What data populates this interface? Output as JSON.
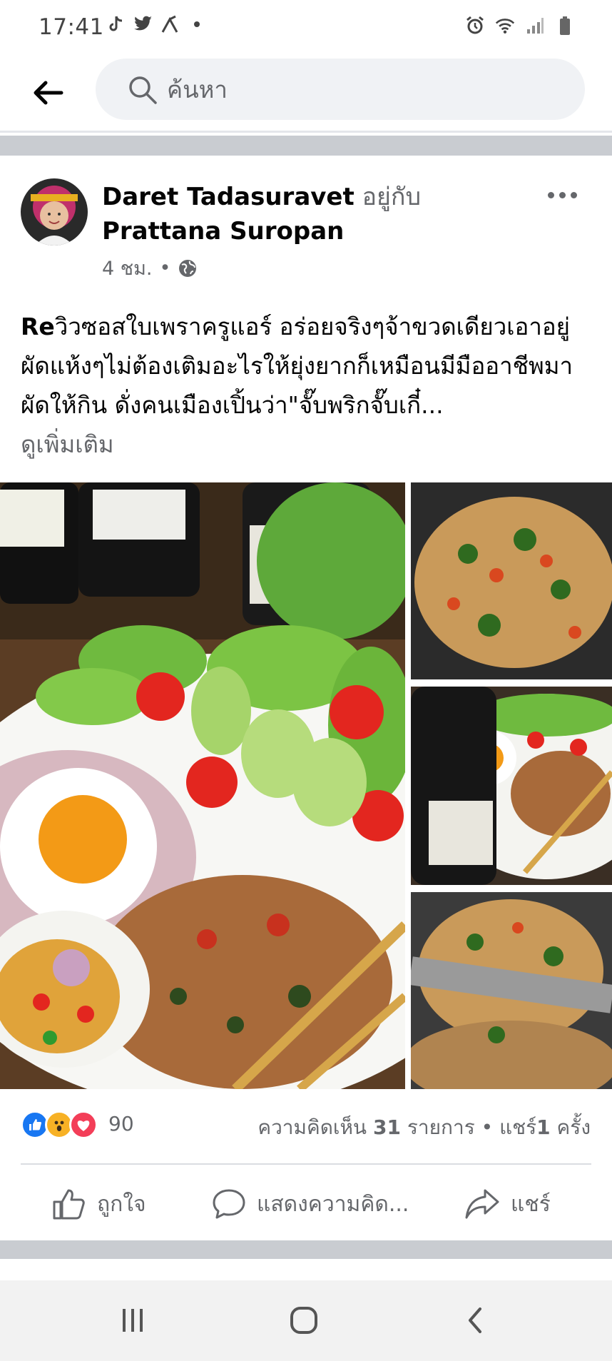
{
  "status_bar": {
    "time": "17:41",
    "left_icons": [
      "tiktok-icon",
      "twitter-icon",
      "app-notification-icon",
      "dot-icon"
    ],
    "right_icons": [
      "alarm-icon",
      "wifi-icon",
      "signal-icon",
      "battery-icon"
    ]
  },
  "header": {
    "back_icon": "back-arrow-icon",
    "search_placeholder": "ค้นหา"
  },
  "post": {
    "author": "Daret Tadasuravet",
    "with_text": "อยู่กับ",
    "tagged": "Prattana Suropan",
    "time": "4 ชม.",
    "separator": "•",
    "privacy_icon": "globe-icon",
    "text_re": "Re",
    "text_body": "วิวซอสใบเพราครูแอร์ อร่อยจริงๆจ้าขวดเดียวเอาอยู่ ผัดแห้งๆไม่ต้องเติมอะไรให้ยุ่งยากก็เหมือนมีมืออาชีพมาผัดให้กิน ดั่งคนเมืองเปิ้นว่า\"จั๊บพริกจั๊บเกี๋...",
    "see_more": "ดูเพิ่มเติม",
    "photos": [
      {
        "alt": "Basil stir-fry with rice, fried egg and sauce bottles"
      },
      {
        "alt": "Basil stir-fry in pan"
      },
      {
        "alt": "Sauce bottle with plated dish"
      },
      {
        "alt": "Stir-frying in wok"
      }
    ]
  },
  "reactions": {
    "icons": [
      "like-reaction-icon",
      "wow-reaction-icon",
      "love-reaction-icon"
    ],
    "count": "90",
    "comments_label": "ความคิดเห็น",
    "comments_count": "31",
    "comments_unit": "รายการ",
    "dot": "•",
    "shares_label": "แชร์",
    "shares_count": "1",
    "shares_unit": "ครั้ง"
  },
  "actions": {
    "like": "ถูกใจ",
    "comment": "แสดงความคิด...",
    "share": "แชร์"
  },
  "colors": {
    "like_blue": "#1877f2",
    "love_red": "#f33e58",
    "wow_yellow": "#f7b125",
    "secondary_text": "#65676b",
    "band_gray": "#c9ccd1"
  }
}
